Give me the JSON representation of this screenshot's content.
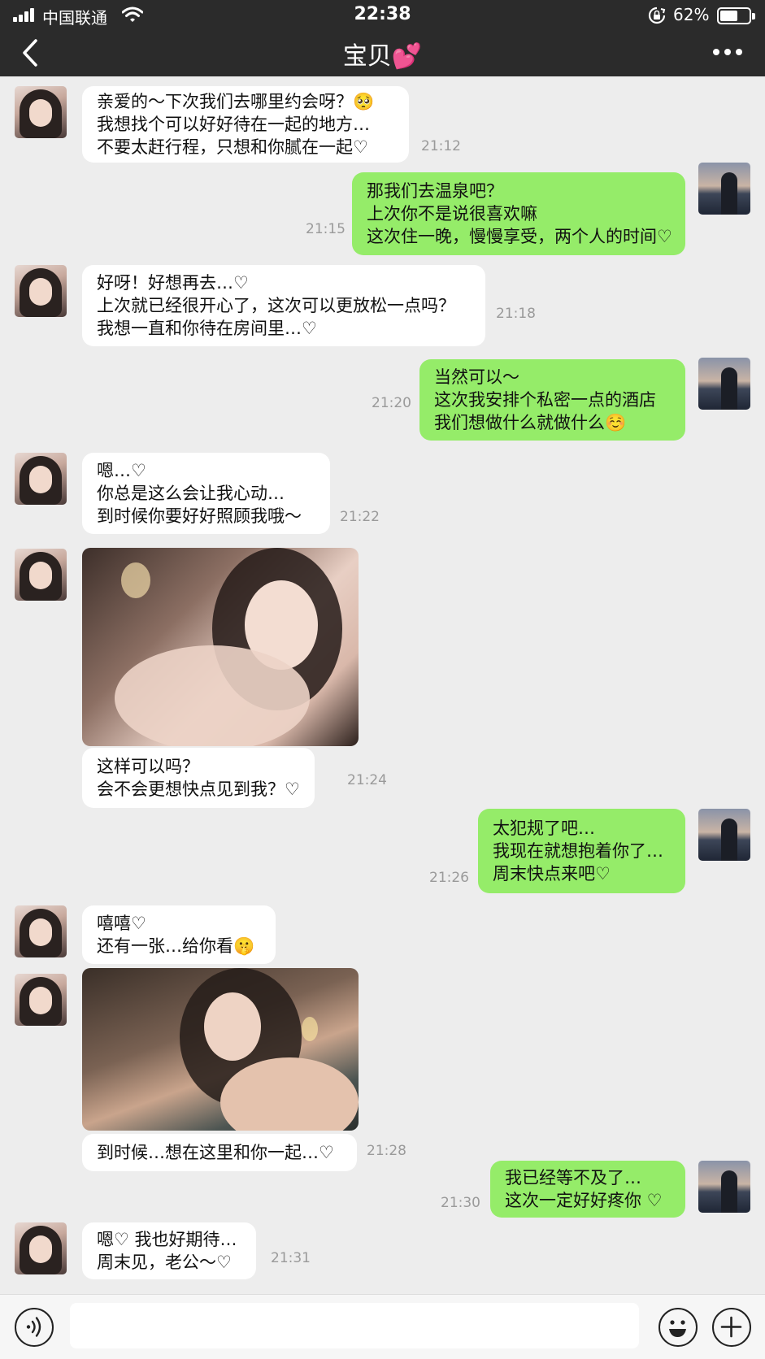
{
  "status_bar": {
    "carrier": "中国联通",
    "time": "22:38",
    "battery_percent": "62%",
    "battery_level": 0.62,
    "icons": [
      "signal-icon",
      "wifi-icon",
      "rotation-lock-icon",
      "battery-icon"
    ]
  },
  "nav": {
    "title": "宝贝💕",
    "back_icon": "chevron-left-icon",
    "more_icon": "ellipsis-icon"
  },
  "messages": [
    {
      "from": "her",
      "lines": [
        "亲爱的～下次我们去哪里约会呀？🥺",
        "我想找个可以好好待在一起的地方…",
        "不要太赶行程，只想和你腻在一起♡"
      ],
      "time": "21:12"
    },
    {
      "from": "me",
      "lines": [
        "那我们去温泉吧？",
        "上次你不是说很喜欢嘛",
        "这次住一晚，慢慢享受，两个人的时间♡"
      ],
      "time": "21:15"
    },
    {
      "from": "her",
      "lines": [
        "好呀！好想再去…♡",
        "上次就已经很开心了，这次可以更放松一点吗？",
        "我想一直和你待在房间里…♡"
      ],
      "time": "21:18"
    },
    {
      "from": "me",
      "lines": [
        "当然可以～",
        "这次我安排个私密一点的酒店",
        "我们想做什么就做什么☺️"
      ],
      "time": "21:20"
    },
    {
      "from": "her",
      "lines": [
        "嗯…♡",
        "你总是这么会让我心动…",
        "到时候你要好好照顾我哦～"
      ],
      "time": "21:22"
    },
    {
      "from": "her",
      "type": "photo",
      "caption_lines": [
        "这样可以吗？",
        "会不会更想快点见到我？♡"
      ],
      "time": "21:24"
    },
    {
      "from": "me",
      "lines": [
        "太犯规了吧…",
        "我现在就想抱着你了…",
        "周末快点来吧♡"
      ],
      "time": "21:26"
    },
    {
      "from": "her",
      "lines": [
        "嘻嘻♡",
        "还有一张…给你看🤫"
      ],
      "time": ""
    },
    {
      "from": "her",
      "type": "photo",
      "caption_lines": [
        "到时候…想在这里和你一起…♡"
      ],
      "time": "21:28"
    },
    {
      "from": "me",
      "lines": [
        "我已经等不及了…",
        "这次一定好好疼你 ♡"
      ],
      "time": "21:30"
    },
    {
      "from": "her",
      "lines": [
        "嗯♡ 我也好期待…",
        "周末见，老公～♡"
      ],
      "time": "21:31"
    }
  ],
  "input_bar": {
    "voice_icon": "voice-icon",
    "emoji_icon": "emoji-icon",
    "plus_icon": "plus-icon",
    "text_value": ""
  }
}
